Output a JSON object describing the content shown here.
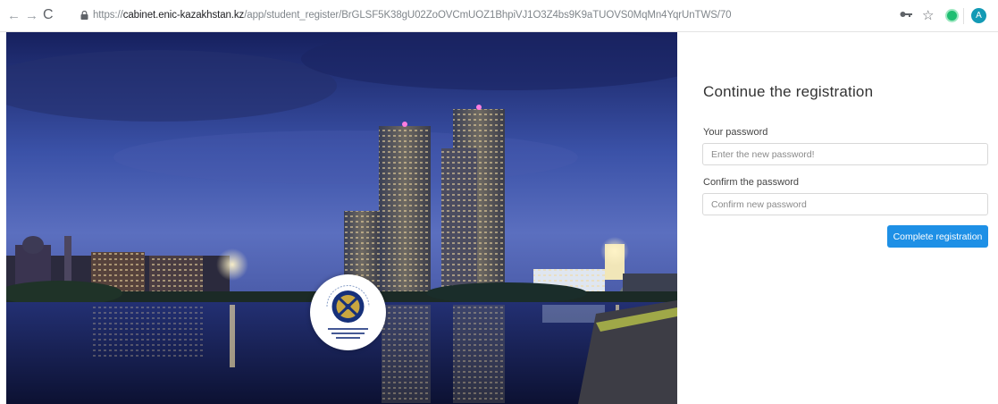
{
  "browser": {
    "url_prefix": "https://",
    "url_host": "cabinet.enic-kazakhstan.kz",
    "url_path": "/app/student_register/BrGLSF5K38gU02ZoOVCmUOZ1BhpiVJ1O3Z4bs9K9aTUOVS0MqMn4YqrUnTWS/70",
    "back_glyph": "←",
    "forward_glyph": "→",
    "reload_glyph": "C",
    "star_glyph": "☆",
    "avatar_letter": "A",
    "icons": [
      "back-arrow-icon",
      "forward-arrow-icon",
      "reload-icon",
      "lock-icon",
      "key-icon",
      "star-icon",
      "extension-icon",
      "profile-avatar"
    ]
  },
  "hero": {
    "description_icon": "city-night-photo",
    "logo_icon": "ministry-emblem"
  },
  "form": {
    "title": "Continue the registration",
    "password_label": "Your password",
    "password_placeholder": "Enter the new password!",
    "password_value": "",
    "confirm_label": "Confirm the password",
    "confirm_placeholder": "Confirm new password",
    "confirm_value": "",
    "submit_label": "Complete registration"
  },
  "colors": {
    "primary_button": "#1e90e6",
    "avatar": "#139ab5",
    "extension": "#1fbe72"
  }
}
